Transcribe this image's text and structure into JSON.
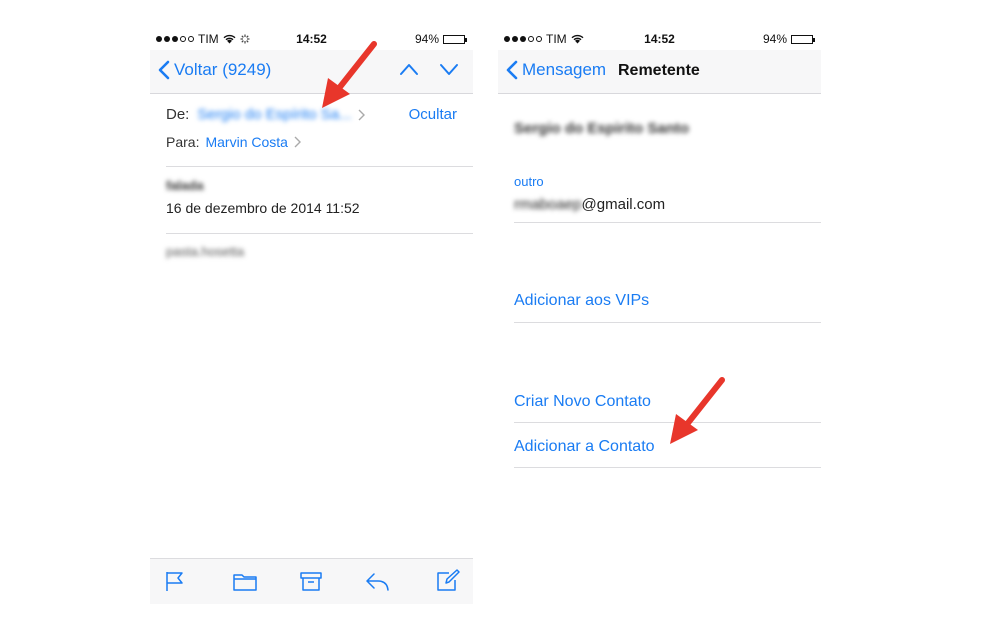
{
  "status_bar": {
    "carrier": "TIM",
    "time": "14:52",
    "battery": "94%",
    "battery_level": 0.94
  },
  "left_screen": {
    "nav": {
      "back_label": "Voltar (9249)",
      "up_icon": "chevron-up-icon",
      "down_icon": "chevron-down-icon"
    },
    "header": {
      "from_label": "De:",
      "from_name": "Sergio do Espírito Sa...",
      "hide_label": "Ocultar",
      "to_label": "Para:",
      "to_name": "Marvin Costa"
    },
    "message": {
      "subject": "falada",
      "date": "16 de dezembro de 2014 11:52",
      "body": "pasta.hosetta"
    },
    "toolbar": [
      "flag-icon",
      "folder-icon",
      "archive-icon",
      "reply-icon",
      "compose-icon"
    ]
  },
  "right_screen": {
    "nav": {
      "back_label": "Mensagem",
      "title": "Remetente"
    },
    "contact": {
      "name": "Sergio do Espirito Santo",
      "email_label": "outro",
      "email_user": "rmaboaep",
      "email_domain": "@gmail.com"
    },
    "actions": {
      "add_vip": "Adicionar aos VIPs",
      "create_contact": "Criar Novo Contato",
      "add_to_contact": "Adicionar a Contato"
    }
  },
  "colors": {
    "ios_blue": "#1a7cf3",
    "arrow_red": "#e8362b",
    "bar_bg": "#f7f7f8"
  }
}
